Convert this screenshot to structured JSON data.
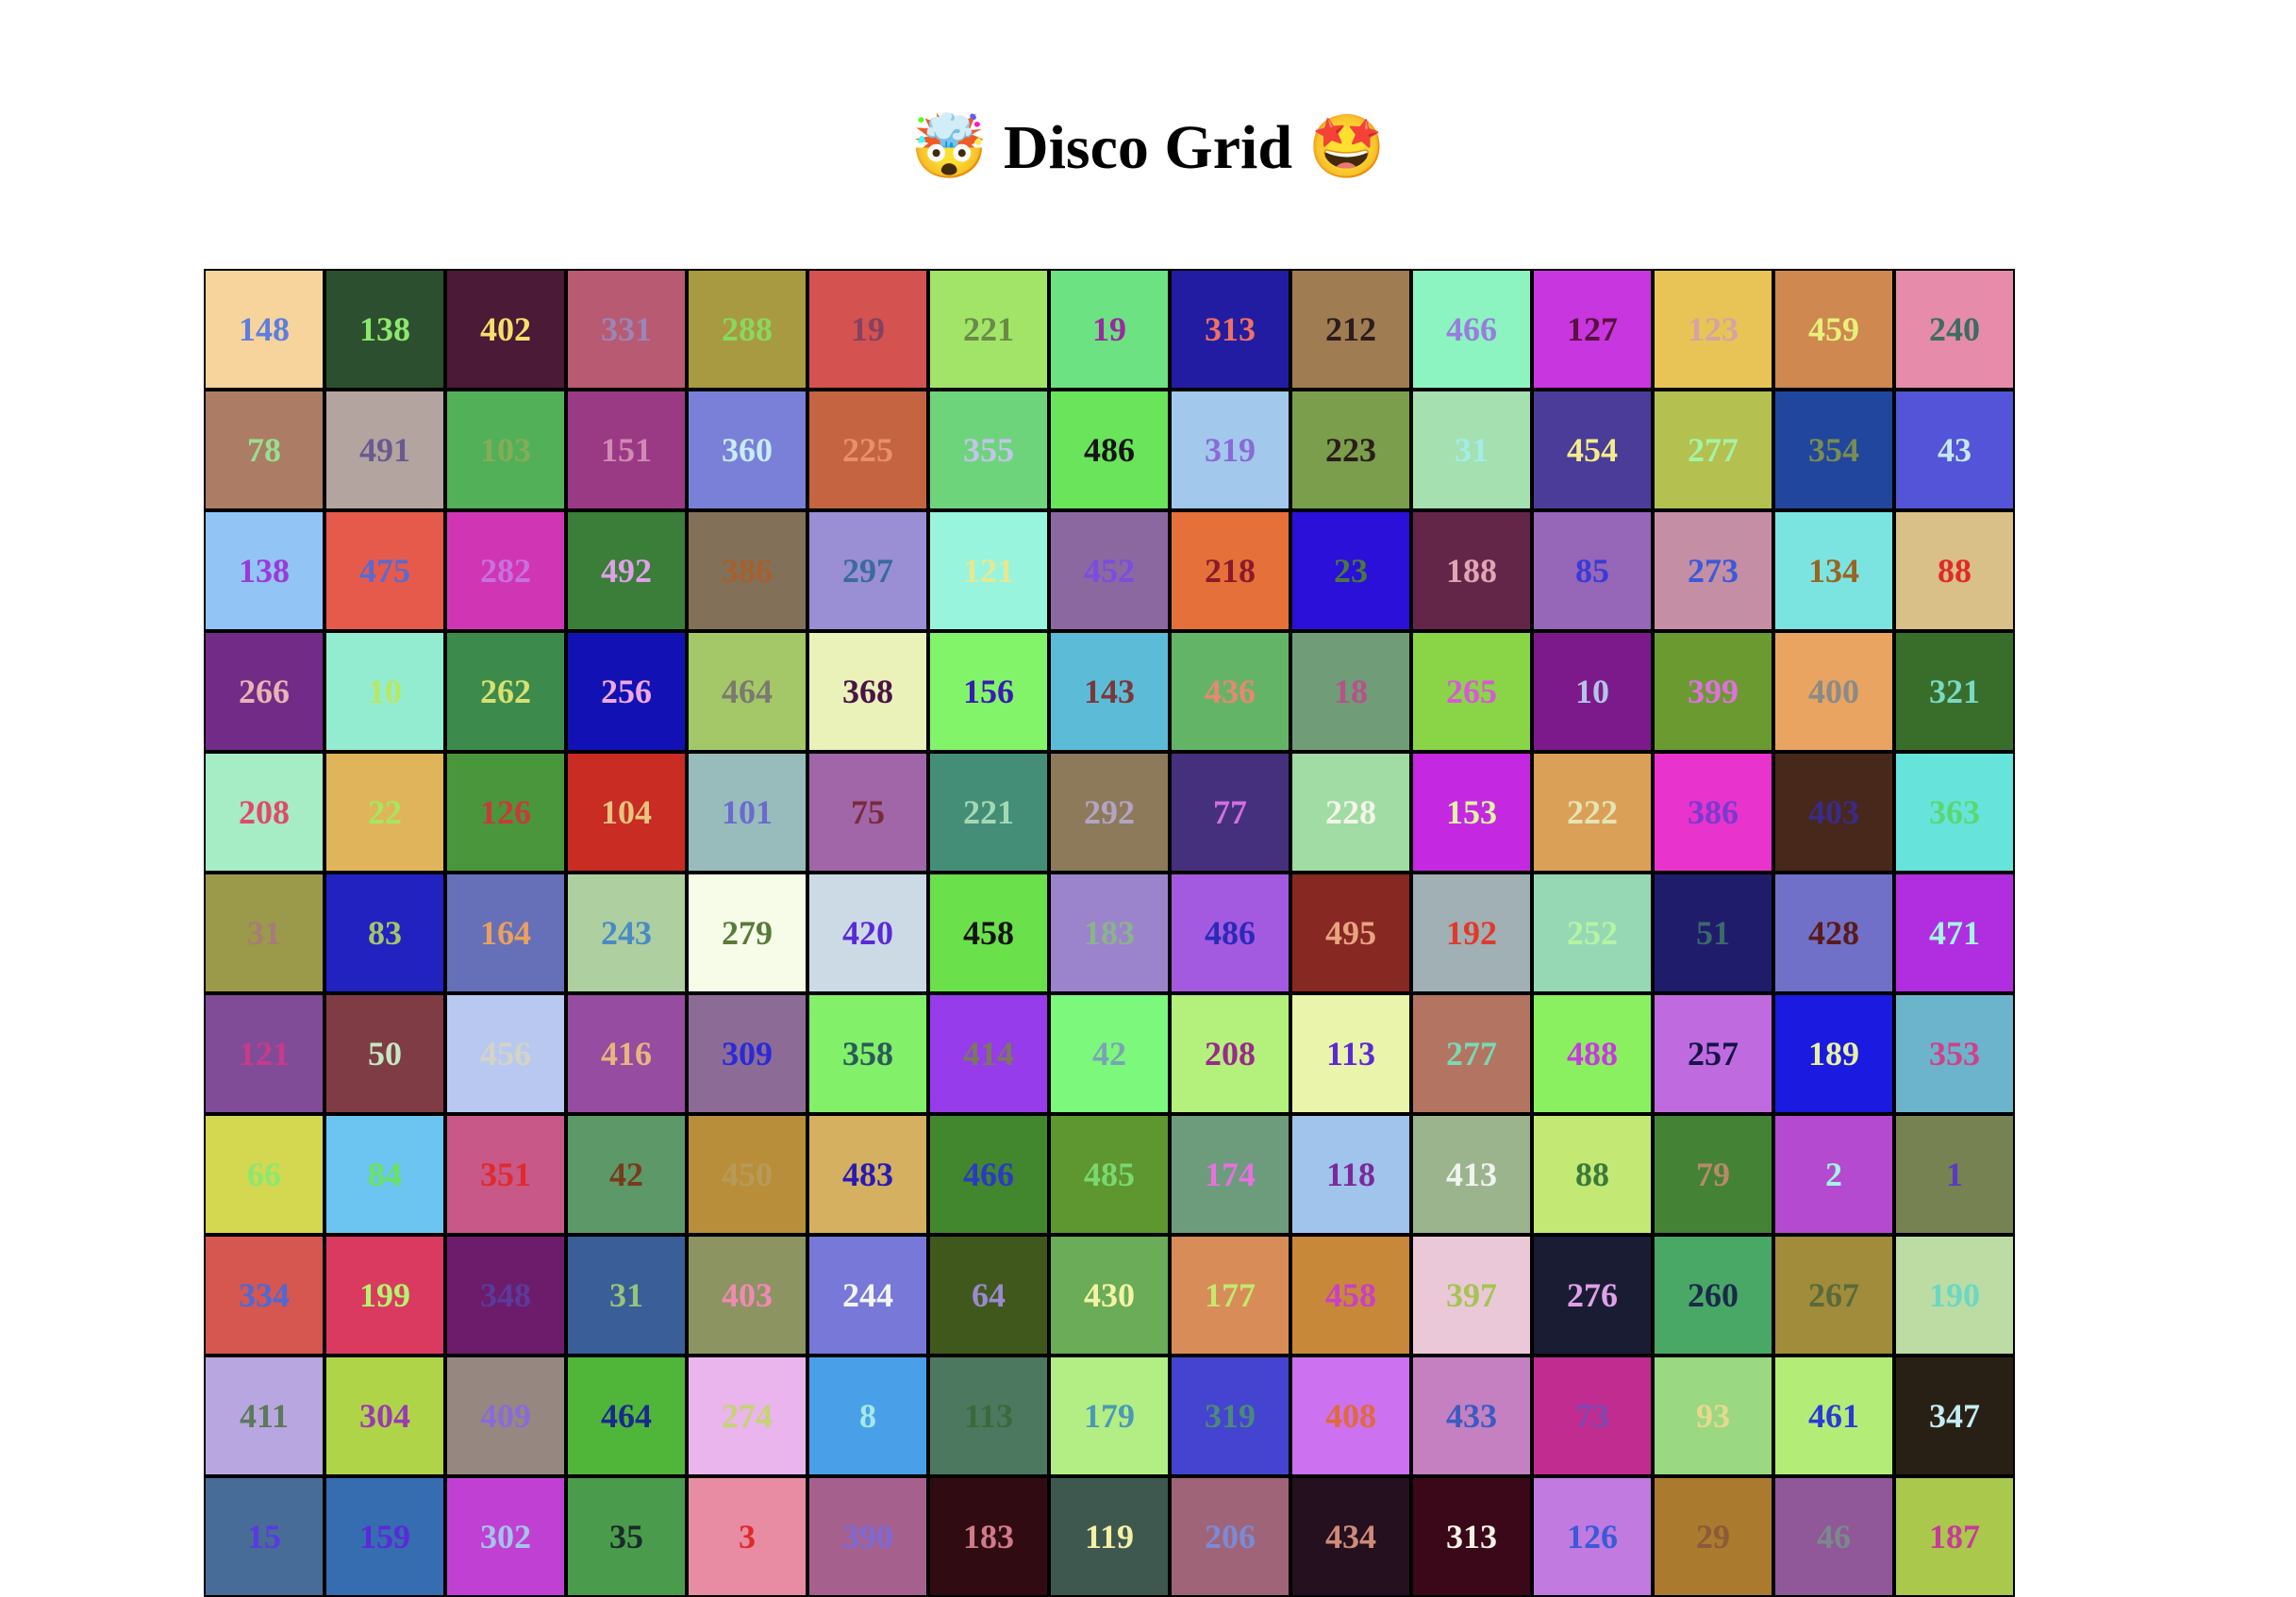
{
  "page": {
    "title": "Disco Grid",
    "emoji_left": "🤯",
    "emoji_right": "🤩"
  },
  "grid": {
    "cells": [
      {
        "n": "148",
        "bg": "#f6d49c",
        "fg": "#5d7ee0"
      },
      {
        "n": "138",
        "bg": "#2c4f30",
        "fg": "#8be86a"
      },
      {
        "n": "402",
        "bg": "#4a1a36",
        "fg": "#f4e06a"
      },
      {
        "n": "331",
        "bg": "#b85a72",
        "fg": "#9a86b8"
      },
      {
        "n": "288",
        "bg": "#a89a40",
        "fg": "#88d860"
      },
      {
        "n": "19",
        "bg": "#d45250",
        "fg": "#864060"
      },
      {
        "n": "221",
        "bg": "#a2e468",
        "fg": "#6a8a48"
      },
      {
        "n": "19",
        "bg": "#6ce282",
        "fg": "#9a2aa0"
      },
      {
        "n": "313",
        "bg": "#221ca2",
        "fg": "#f07060"
      },
      {
        "n": "212",
        "bg": "#a07c52",
        "fg": "#2c1c1c"
      },
      {
        "n": "466",
        "bg": "#8cf4c0",
        "fg": "#9a7ce0"
      },
      {
        "n": "127",
        "bg": "#c836e0",
        "fg": "#5a1040"
      },
      {
        "n": "123",
        "bg": "#e8c456",
        "fg": "#d4a4a4"
      },
      {
        "n": "459",
        "bg": "#ce8850",
        "fg": "#e8f07a"
      },
      {
        "n": "240",
        "bg": "#e68caa",
        "fg": "#3e6c62"
      },
      {
        "n": "78",
        "bg": "#ac7c64",
        "fg": "#96e090"
      },
      {
        "n": "491",
        "bg": "#b4a4a0",
        "fg": "#6a5a90"
      },
      {
        "n": "103",
        "bg": "#52b058",
        "fg": "#86ac58"
      },
      {
        "n": "151",
        "bg": "#9a3a84",
        "fg": "#d08ab4"
      },
      {
        "n": "360",
        "bg": "#7a80d8",
        "fg": "#c8ecf4"
      },
      {
        "n": "225",
        "bg": "#c46440",
        "fg": "#e89068"
      },
      {
        "n": "355",
        "bg": "#6ed47c",
        "fg": "#c4c4ec"
      },
      {
        "n": "486",
        "bg": "#6ae45a",
        "fg": "#141414"
      },
      {
        "n": "319",
        "bg": "#a2c8ec",
        "fg": "#8a6ad8"
      },
      {
        "n": "223",
        "bg": "#7a9e4c",
        "fg": "#2c1c1c"
      },
      {
        "n": "31",
        "bg": "#a4e0b0",
        "fg": "#a4ece8"
      },
      {
        "n": "454",
        "bg": "#4a3c98",
        "fg": "#f4ec8a"
      },
      {
        "n": "277",
        "bg": "#b4c050",
        "fg": "#a4f4a4"
      },
      {
        "n": "354",
        "bg": "#20469e",
        "fg": "#7a8c50"
      },
      {
        "n": "43",
        "bg": "#5454d8",
        "fg": "#c4e8f4"
      },
      {
        "n": "138",
        "bg": "#92c4f6",
        "fg": "#9a3ad8"
      },
      {
        "n": "475",
        "bg": "#e65a4c",
        "fg": "#5a6ad0"
      },
      {
        "n": "282",
        "bg": "#d036b4",
        "fg": "#c870e0"
      },
      {
        "n": "492",
        "bg": "#3a7e3a",
        "fg": "#e0a0e8"
      },
      {
        "n": "386",
        "bg": "#827058",
        "fg": "#a66030"
      },
      {
        "n": "297",
        "bg": "#9a8ed4",
        "fg": "#3a6aa0"
      },
      {
        "n": "121",
        "bg": "#98f4dc",
        "fg": "#e8e890"
      },
      {
        "n": "452",
        "bg": "#8c68a0",
        "fg": "#7a4ce0"
      },
      {
        "n": "218",
        "bg": "#e6703a",
        "fg": "#8a1a2a"
      },
      {
        "n": "23",
        "bg": "#2a10d8",
        "fg": "#4a7a3a"
      },
      {
        "n": "188",
        "bg": "#642648",
        "fg": "#e0a4b4"
      },
      {
        "n": "85",
        "bg": "#9666b8",
        "fg": "#3a3ad8"
      },
      {
        "n": "273",
        "bg": "#c48ea4",
        "fg": "#3a5ad8"
      },
      {
        "n": "134",
        "bg": "#7ce4e0",
        "fg": "#9a6420"
      },
      {
        "n": "88",
        "bg": "#d8c088",
        "fg": "#e02a2a"
      },
      {
        "n": "266",
        "bg": "#722c88",
        "fg": "#e8b4b4"
      },
      {
        "n": "10",
        "bg": "#94ecd0",
        "fg": "#b8e860"
      },
      {
        "n": "262",
        "bg": "#3c8a4c",
        "fg": "#d8e070"
      },
      {
        "n": "256",
        "bg": "#1212b4",
        "fg": "#f0a8e0"
      },
      {
        "n": "464",
        "bg": "#a4c868",
        "fg": "#7a7a70"
      },
      {
        "n": "368",
        "bg": "#eaf2ba",
        "fg": "#4a1448"
      },
      {
        "n": "156",
        "bg": "#82f46a",
        "fg": "#3a1ab4"
      },
      {
        "n": "143",
        "bg": "#5cbcd8",
        "fg": "#7a3838"
      },
      {
        "n": "436",
        "bg": "#64b468",
        "fg": "#e88870"
      },
      {
        "n": "18",
        "bg": "#709c78",
        "fg": "#b8508a"
      },
      {
        "n": "265",
        "bg": "#8ad448",
        "fg": "#d858d8"
      },
      {
        "n": "10",
        "bg": "#7c1a8c",
        "fg": "#b4c4e8"
      },
      {
        "n": "399",
        "bg": "#6a9a30",
        "fg": "#e070e0"
      },
      {
        "n": "400",
        "bg": "#e8a460",
        "fg": "#8a8a88"
      },
      {
        "n": "321",
        "bg": "#386e2a",
        "fg": "#7ad8c4"
      },
      {
        "n": "208",
        "bg": "#a6ecc4",
        "fg": "#e04a6a"
      },
      {
        "n": "22",
        "bg": "#e0b45a",
        "fg": "#a4e860"
      },
      {
        "n": "126",
        "bg": "#4a963c",
        "fg": "#c83a3a"
      },
      {
        "n": "104",
        "bg": "#c82c22",
        "fg": "#e8c480"
      },
      {
        "n": "101",
        "bg": "#98bcbc",
        "fg": "#6a6ad0"
      },
      {
        "n": "75",
        "bg": "#a066a8",
        "fg": "#7a2a3a"
      },
      {
        "n": "221",
        "bg": "#448e78",
        "fg": "#a4d8b4"
      },
      {
        "n": "292",
        "bg": "#8c7a5a",
        "fg": "#b4a4c4"
      },
      {
        "n": "77",
        "bg": "#44307c",
        "fg": "#d070e0"
      },
      {
        "n": "228",
        "bg": "#a0dca4",
        "fg": "#f4f4e8"
      },
      {
        "n": "153",
        "bg": "#c428e0",
        "fg": "#e0f4a4"
      },
      {
        "n": "222",
        "bg": "#daa058",
        "fg": "#e4e4b4"
      },
      {
        "n": "386",
        "bg": "#e834cc",
        "fg": "#7a3ad0"
      },
      {
        "n": "403",
        "bg": "#48281a",
        "fg": "#3a2a8a"
      },
      {
        "n": "363",
        "bg": "#66e4dc",
        "fg": "#5ad870"
      },
      {
        "n": "31",
        "bg": "#9a9a4a",
        "fg": "#a87a7a"
      },
      {
        "n": "83",
        "bg": "#2222c0",
        "fg": "#a4c468"
      },
      {
        "n": "164",
        "bg": "#6670b8",
        "fg": "#e8a060"
      },
      {
        "n": "243",
        "bg": "#aed0a0",
        "fg": "#4a8ac4"
      },
      {
        "n": "279",
        "bg": "#f6fce8",
        "fg": "#5a7a3a"
      },
      {
        "n": "420",
        "bg": "#ccdae6",
        "fg": "#5a2ad8"
      },
      {
        "n": "458",
        "bg": "#6ae04a",
        "fg": "#141414"
      },
      {
        "n": "183",
        "bg": "#9c84cc",
        "fg": "#8ab48a"
      },
      {
        "n": "486",
        "bg": "#a45ae0",
        "fg": "#2a2ab8"
      },
      {
        "n": "495",
        "bg": "#882822",
        "fg": "#e8a480"
      },
      {
        "n": "192",
        "bg": "#a0b0b4",
        "fg": "#e03a2a"
      },
      {
        "n": "252",
        "bg": "#96d8b4",
        "fg": "#b4f4a4"
      },
      {
        "n": "51",
        "bg": "#201c6c",
        "fg": "#3a6a6a"
      },
      {
        "n": "428",
        "bg": "#7070c8",
        "fg": "#5a1a1a"
      },
      {
        "n": "471",
        "bg": "#b02ee0",
        "fg": "#a4f4e8"
      },
      {
        "n": "121",
        "bg": "#804c98",
        "fg": "#c83a8a"
      },
      {
        "n": "50",
        "bg": "#803c44",
        "fg": "#c4e8c4"
      },
      {
        "n": "456",
        "bg": "#b8c8f0",
        "fg": "#d4d4c4"
      },
      {
        "n": "416",
        "bg": "#964ca0",
        "fg": "#e8b480"
      },
      {
        "n": "309",
        "bg": "#8c6c96",
        "fg": "#2a2ad8"
      },
      {
        "n": "358",
        "bg": "#82f068",
        "fg": "#2a5a5a"
      },
      {
        "n": "414",
        "bg": "#963cea",
        "fg": "#7a7a5a"
      },
      {
        "n": "42",
        "bg": "#7cf87c",
        "fg": "#7aa4b4"
      },
      {
        "n": "208",
        "bg": "#b4f07c",
        "fg": "#9a2a8a"
      },
      {
        "n": "113",
        "bg": "#eaf4aa",
        "fg": "#5a2ad8"
      },
      {
        "n": "277",
        "bg": "#b47462",
        "fg": "#7ad8b4"
      },
      {
        "n": "488",
        "bg": "#8af060",
        "fg": "#c83ae0"
      },
      {
        "n": "257",
        "bg": "#c06ae0",
        "fg": "#141448"
      },
      {
        "n": "189",
        "bg": "#1a1ae0",
        "fg": "#e8f0a4"
      },
      {
        "n": "353",
        "bg": "#6cb4cc",
        "fg": "#d0408a"
      },
      {
        "n": "66",
        "bg": "#d4d850",
        "fg": "#8ae870"
      },
      {
        "n": "84",
        "bg": "#6cc4f0",
        "fg": "#6ae45a"
      },
      {
        "n": "351",
        "bg": "#c85888",
        "fg": "#e02a2a"
      },
      {
        "n": "42",
        "bg": "#5c9868",
        "fg": "#7a3a1a"
      },
      {
        "n": "450",
        "bg": "#b88e3a",
        "fg": "#b89a58"
      },
      {
        "n": "483",
        "bg": "#d4b060",
        "fg": "#2a1ab4"
      },
      {
        "n": "466",
        "bg": "#42862e",
        "fg": "#2a3ac4"
      },
      {
        "n": "485",
        "bg": "#5e9630",
        "fg": "#7ad870"
      },
      {
        "n": "174",
        "bg": "#6c9c7c",
        "fg": "#e870e0"
      },
      {
        "n": "118",
        "bg": "#a0c4ec",
        "fg": "#7a2a9a"
      },
      {
        "n": "413",
        "bg": "#9cb48e",
        "fg": "#f0f4f0"
      },
      {
        "n": "88",
        "bg": "#c4e874",
        "fg": "#3a7a3a"
      },
      {
        "n": "79",
        "bg": "#448236",
        "fg": "#b88a6a"
      },
      {
        "n": "2",
        "bg": "#b44ad0",
        "fg": "#a4f4e8"
      },
      {
        "n": "1",
        "bg": "#768252",
        "fg": "#5a3ac4"
      },
      {
        "n": "334",
        "bg": "#d65650",
        "fg": "#4a6ad8"
      },
      {
        "n": "199",
        "bg": "#da3a60",
        "fg": "#b4f470"
      },
      {
        "n": "348",
        "bg": "#6c1c6a",
        "fg": "#5a3a9a"
      },
      {
        "n": "31",
        "bg": "#3a5e98",
        "fg": "#96c47a"
      },
      {
        "n": "403",
        "bg": "#8c9462",
        "fg": "#f08ab4"
      },
      {
        "n": "244",
        "bg": "#7878d8",
        "fg": "#f4f4f4"
      },
      {
        "n": "64",
        "bg": "#40581c",
        "fg": "#9a8ad0"
      },
      {
        "n": "430",
        "bg": "#6aac58",
        "fg": "#f4f4a4"
      },
      {
        "n": "177",
        "bg": "#d88c58",
        "fg": "#c4e870"
      },
      {
        "n": "458",
        "bg": "#c8883a",
        "fg": "#c840c4"
      },
      {
        "n": "397",
        "bg": "#eac8d8",
        "fg": "#a4c450"
      },
      {
        "n": "276",
        "bg": "#1a1c34",
        "fg": "#e0a0e8"
      },
      {
        "n": "260",
        "bg": "#4aa866",
        "fg": "#1a2a4a"
      },
      {
        "n": "267",
        "bg": "#a08c3a",
        "fg": "#5a6a3a"
      },
      {
        "n": "190",
        "bg": "#bcdca4",
        "fg": "#6ad8c4"
      },
      {
        "n": "411",
        "bg": "#b8a6e0",
        "fg": "#5a7a5a"
      },
      {
        "n": "304",
        "bg": "#b0d448",
        "fg": "#9a3ab4"
      },
      {
        "n": "409",
        "bg": "#968880",
        "fg": "#8a6ad8"
      },
      {
        "n": "464",
        "bg": "#50b63a",
        "fg": "#1a2a8a"
      },
      {
        "n": "274",
        "bg": "#eab4ec",
        "fg": "#c4d470"
      },
      {
        "n": "8",
        "bg": "#4aa0e8",
        "fg": "#a4e8e8"
      },
      {
        "n": "113",
        "bg": "#4c7860",
        "fg": "#3a6a3a"
      },
      {
        "n": "179",
        "bg": "#b2ee84",
        "fg": "#4a9ab4"
      },
      {
        "n": "319",
        "bg": "#4444d0",
        "fg": "#4a8a7a"
      },
      {
        "n": "408",
        "bg": "#cc72f0",
        "fg": "#e06a3a"
      },
      {
        "n": "433",
        "bg": "#c480c0",
        "fg": "#3a5ac4"
      },
      {
        "n": "73",
        "bg": "#c02c90",
        "fg": "#7a4ab4"
      },
      {
        "n": "93",
        "bg": "#9ad882",
        "fg": "#e8d890"
      },
      {
        "n": "461",
        "bg": "#b4ec78",
        "fg": "#2a3ad8"
      },
      {
        "n": "347",
        "bg": "#282014",
        "fg": "#c4ecf4"
      },
      {
        "n": "15",
        "bg": "#486c98",
        "fg": "#5a3ae0"
      },
      {
        "n": "159",
        "bg": "#366cb0",
        "fg": "#5a2ad8"
      },
      {
        "n": "302",
        "bg": "#c040d4",
        "fg": "#a4c4e8"
      },
      {
        "n": "35",
        "bg": "#4a9c4c",
        "fg": "#1a2a2a"
      },
      {
        "n": "3",
        "bg": "#e88ca4",
        "fg": "#e02a2a"
      },
      {
        "n": "390",
        "bg": "#a6608e",
        "fg": "#7a6ad8"
      },
      {
        "n": "183",
        "bg": "#300c12",
        "fg": "#d07a8a"
      },
      {
        "n": "119",
        "bg": "#3e5850",
        "fg": "#f4f0a4"
      },
      {
        "n": "206",
        "bg": "#a06478",
        "fg": "#7a8ad8"
      },
      {
        "n": "434",
        "bg": "#24101e",
        "fg": "#d08a7a"
      },
      {
        "n": "313",
        "bg": "#3a0818",
        "fg": "#f4f4e8"
      },
      {
        "n": "126",
        "bg": "#c07ae0",
        "fg": "#3a5ad8"
      },
      {
        "n": "29",
        "bg": "#aa7a2e",
        "fg": "#8a5a3a"
      },
      {
        "n": "46",
        "bg": "#905898",
        "fg": "#7a8a8a"
      },
      {
        "n": "187",
        "bg": "#aac84c",
        "fg": "#c83a9a"
      }
    ]
  }
}
